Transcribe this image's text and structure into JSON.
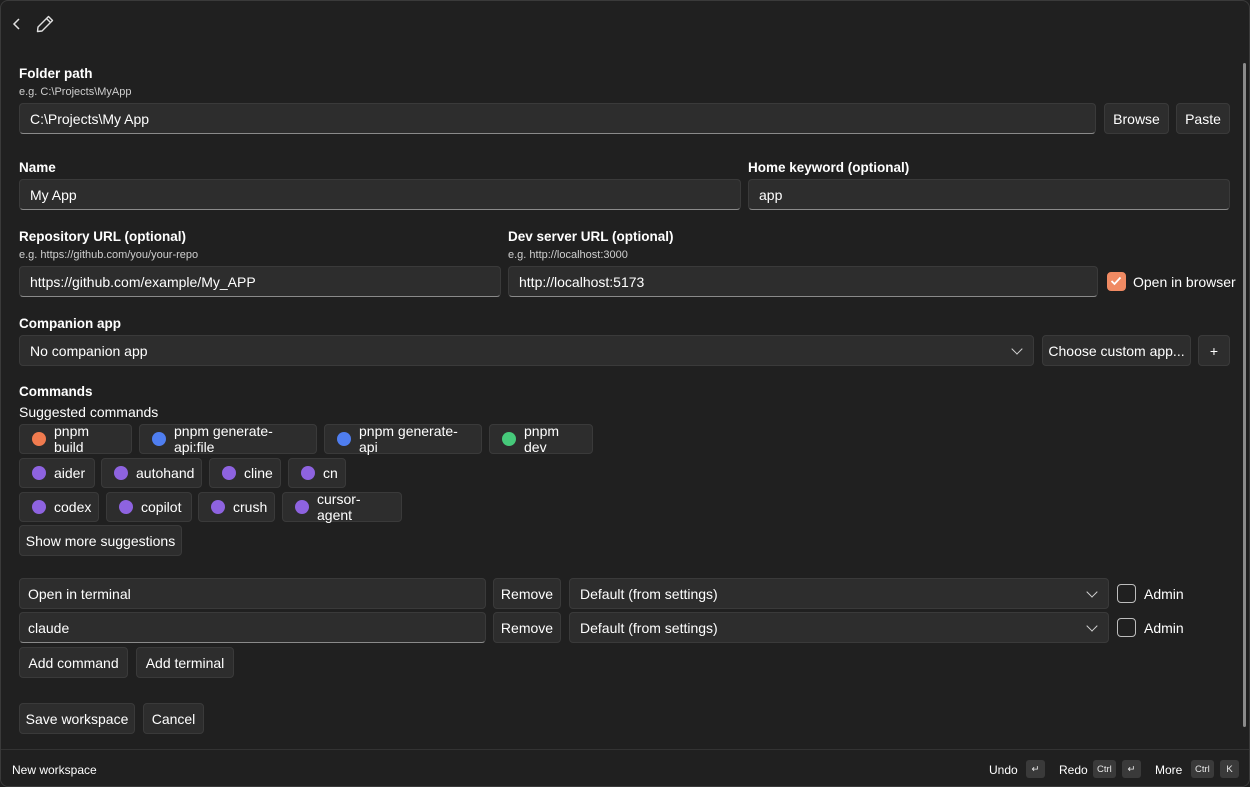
{
  "header": {
    "back_icon": "chevron-left-icon",
    "edit_icon": "pencil-icon"
  },
  "folder": {
    "label": "Folder path",
    "hint": "e.g. C:\\Projects\\MyApp",
    "value": "C:\\Projects\\My App",
    "browse": "Browse",
    "paste": "Paste"
  },
  "name": {
    "label": "Name",
    "value": "My App"
  },
  "home_keyword": {
    "label": "Home keyword (optional)",
    "value": "app"
  },
  "repo": {
    "label": "Repository URL (optional)",
    "hint": "e.g. https://github.com/you/your-repo",
    "value": "https://github.com/example/My_APP"
  },
  "dev_server": {
    "label": "Dev server URL (optional)",
    "hint": "e.g. http://localhost:3000",
    "value": "http://localhost:5173",
    "open_in_browser": "Open in browser",
    "open_in_browser_checked": true
  },
  "companion": {
    "label": "Companion app",
    "selected": "No companion app",
    "choose_custom": "Choose custom app...",
    "add": "+"
  },
  "commands": {
    "label": "Commands",
    "suggested_label": "Suggested commands",
    "suggestions": [
      {
        "label": "pnpm build",
        "color": "#f07b4f"
      },
      {
        "label": "pnpm generate-api:file",
        "color": "#4f7ef0"
      },
      {
        "label": "pnpm generate-api",
        "color": "#4f7ef0"
      },
      {
        "label": "pnpm dev",
        "color": "#46c97a"
      },
      {
        "label": "aider",
        "color": "#8e63e0"
      },
      {
        "label": "autohand",
        "color": "#8e63e0"
      },
      {
        "label": "cline",
        "color": "#8e63e0"
      },
      {
        "label": "cn",
        "color": "#8e63e0"
      },
      {
        "label": "codex",
        "color": "#8e63e0"
      },
      {
        "label": "copilot",
        "color": "#8e63e0"
      },
      {
        "label": "crush",
        "color": "#8e63e0"
      },
      {
        "label": "cursor-agent",
        "color": "#8e63e0"
      }
    ],
    "show_more": "Show more suggestions",
    "rows": [
      {
        "command": "Open in terminal",
        "remove": "Remove",
        "terminal": "Default (from settings)",
        "admin": "Admin"
      },
      {
        "command": "claude",
        "remove": "Remove",
        "terminal": "Default (from settings)",
        "admin": "Admin"
      }
    ],
    "add_command": "Add command",
    "add_terminal": "Add terminal"
  },
  "actions": {
    "save": "Save workspace",
    "cancel": "Cancel"
  },
  "footer": {
    "title": "New workspace",
    "undo": "Undo",
    "redo": "Redo",
    "more": "More",
    "ctrl": "Ctrl",
    "k": "K",
    "enter_glyph": "↵"
  },
  "colors": {
    "accent": "#f08a63",
    "background": "#202020",
    "field": "#2d2d2d"
  }
}
